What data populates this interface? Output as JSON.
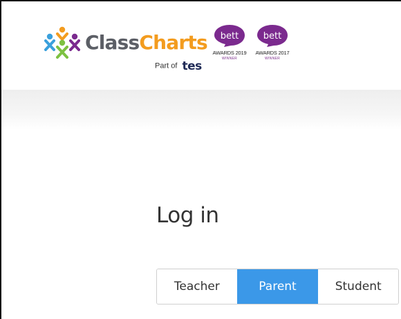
{
  "header": {
    "brand": {
      "name_part1": "Class",
      "name_part2": "Charts",
      "part_of_text": "Part of",
      "part_of_logo": "tes",
      "colors": {
        "class": "#5c5f66",
        "charts": "#f39c1f",
        "tes": "#1f2a56"
      }
    },
    "awards": [
      {
        "badge": "bett",
        "line": "AWARDS 2019",
        "sub": "WINNER"
      },
      {
        "badge": "bett",
        "line": "AWARDS 2017",
        "sub": "WINNER"
      }
    ],
    "badge_color": "#7b2a8e"
  },
  "login": {
    "title": "Log in",
    "roles": [
      {
        "label": "Teacher",
        "active": false
      },
      {
        "label": "Parent",
        "active": true
      },
      {
        "label": "Student",
        "active": false
      }
    ],
    "active_color": "#3b98e8"
  }
}
